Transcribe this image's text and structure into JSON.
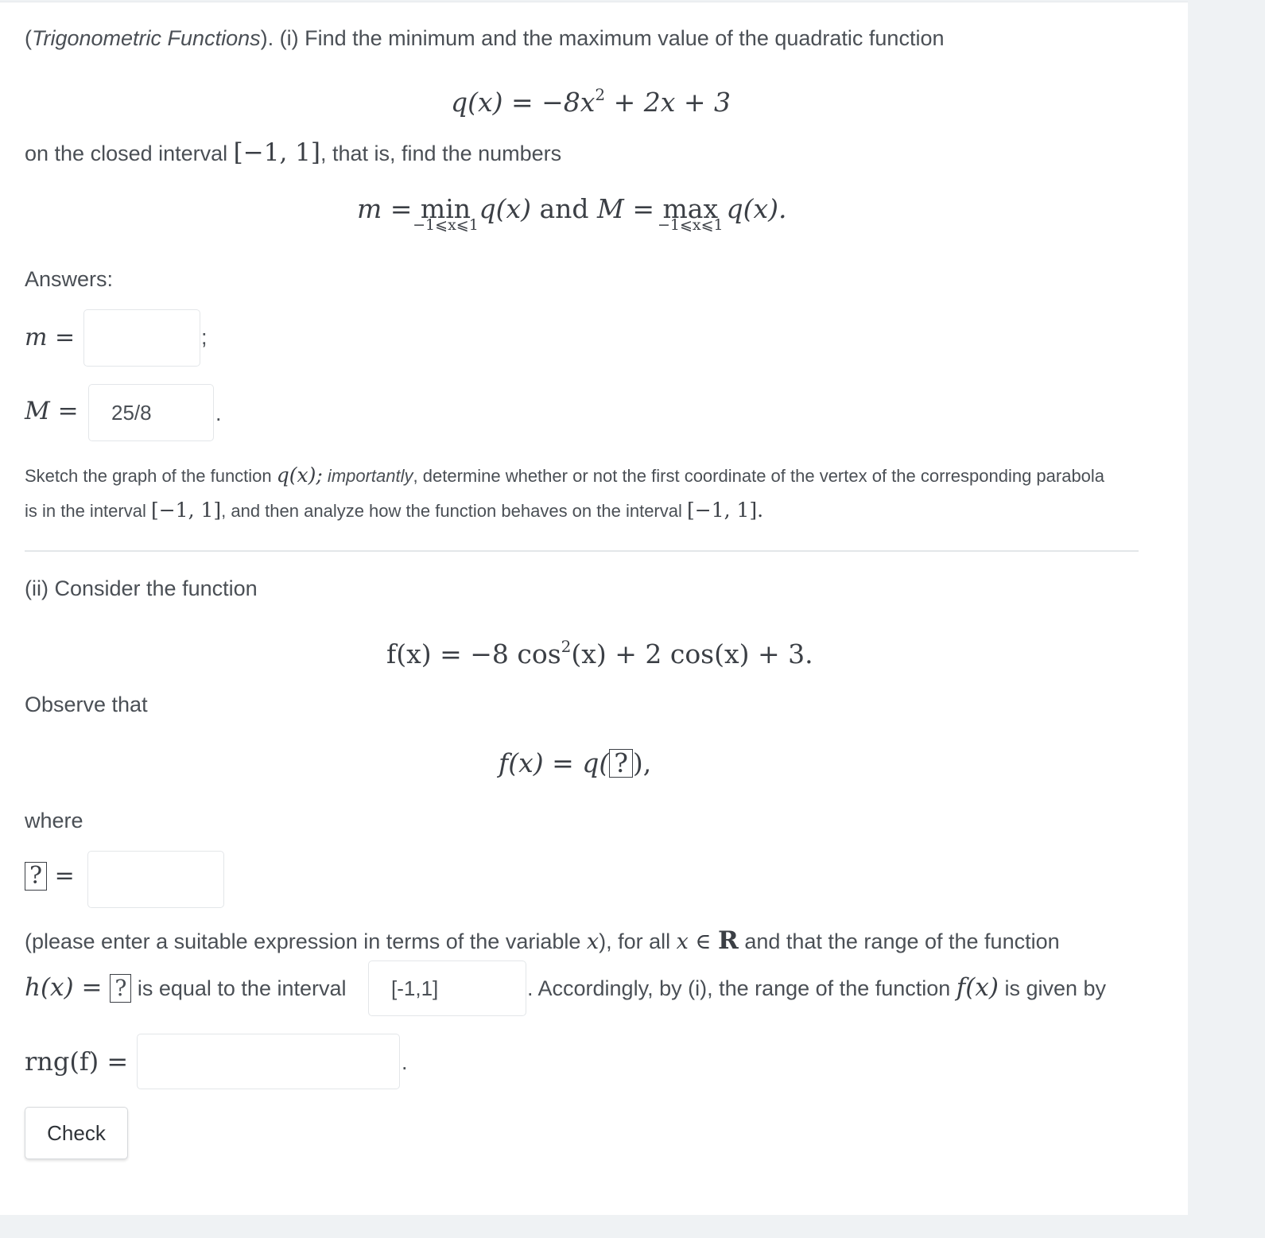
{
  "part_i": {
    "intro_italic": "Trigonometric Functions",
    "intro_rest": "). (i) Find the minimum and the maximum value of the quadratic function",
    "intro_open": "(",
    "q_def": {
      "lhs": "q(x) = ",
      "rhs_a": "−8x",
      "rhs_exp": "2",
      "rhs_b": " + 2x + 3"
    },
    "interval_text_before": "on the closed interval ",
    "interval": "[−1, 1]",
    "interval_text_after": ", that is, find the numbers",
    "minmax": {
      "m_lhs": "m = ",
      "min_op": "min",
      "min_sub": "−1⩽x⩽1",
      "q_after_min": " q(x) ",
      "and": "and",
      "M_lhs": " M = ",
      "max_op": "max",
      "max_sub": "−1⩽x⩽1",
      "q_after_max": " q(x)."
    },
    "answers_label": "Answers:",
    "m_label": "m =",
    "m_value": "",
    "m_suffix": ";",
    "M_label": "M =",
    "M_value": "25/8",
    "M_suffix": ".",
    "hint_line1_a": "Sketch the graph of the function ",
    "hint_line1_math": "q(x);",
    "hint_line1_italic": " importantly",
    "hint_line1_b": ", determine whether or not the first coordinate of the vertex of the corresponding parabola",
    "hint_line2_a": "is in the interval ",
    "hint_line2_interval1": "[−1, 1]",
    "hint_line2_b": ", and then analyze how the function behaves on the interval ",
    "hint_line2_interval2": "[−1, 1]."
  },
  "part_ii": {
    "consider": "(ii) Consider the function",
    "f_def": {
      "lhs": "f(x) = −8 cos",
      "exp": "2",
      "rhs": "(x) + 2 cos(x) + 3."
    },
    "observe": "Observe that",
    "f_eq_a": "f(x) = q(",
    "f_eq_box": "?",
    "f_eq_b": "),",
    "where": "where",
    "box_label": "?",
    "box_eq": "=",
    "box_value": "",
    "please_a": "(please enter a suitable expression in terms of the variable ",
    "please_x": "x",
    "please_b": "), for all ",
    "please_x2": "x ∈ ",
    "please_R": "R",
    "please_c": " and that the range of the function",
    "h_lhs": "h(x) = ",
    "h_box": "?",
    "h_text": " is equal to the interval",
    "h_interval_value": "[-1,1]",
    "accordingly_a": ". Accordingly, by (i), the range of the function ",
    "accordingly_f": "f(x)",
    "accordingly_b": " is given by",
    "rng_label": "rng(f) =",
    "rng_value": "",
    "rng_suffix": "."
  },
  "check_button_label": "Check"
}
